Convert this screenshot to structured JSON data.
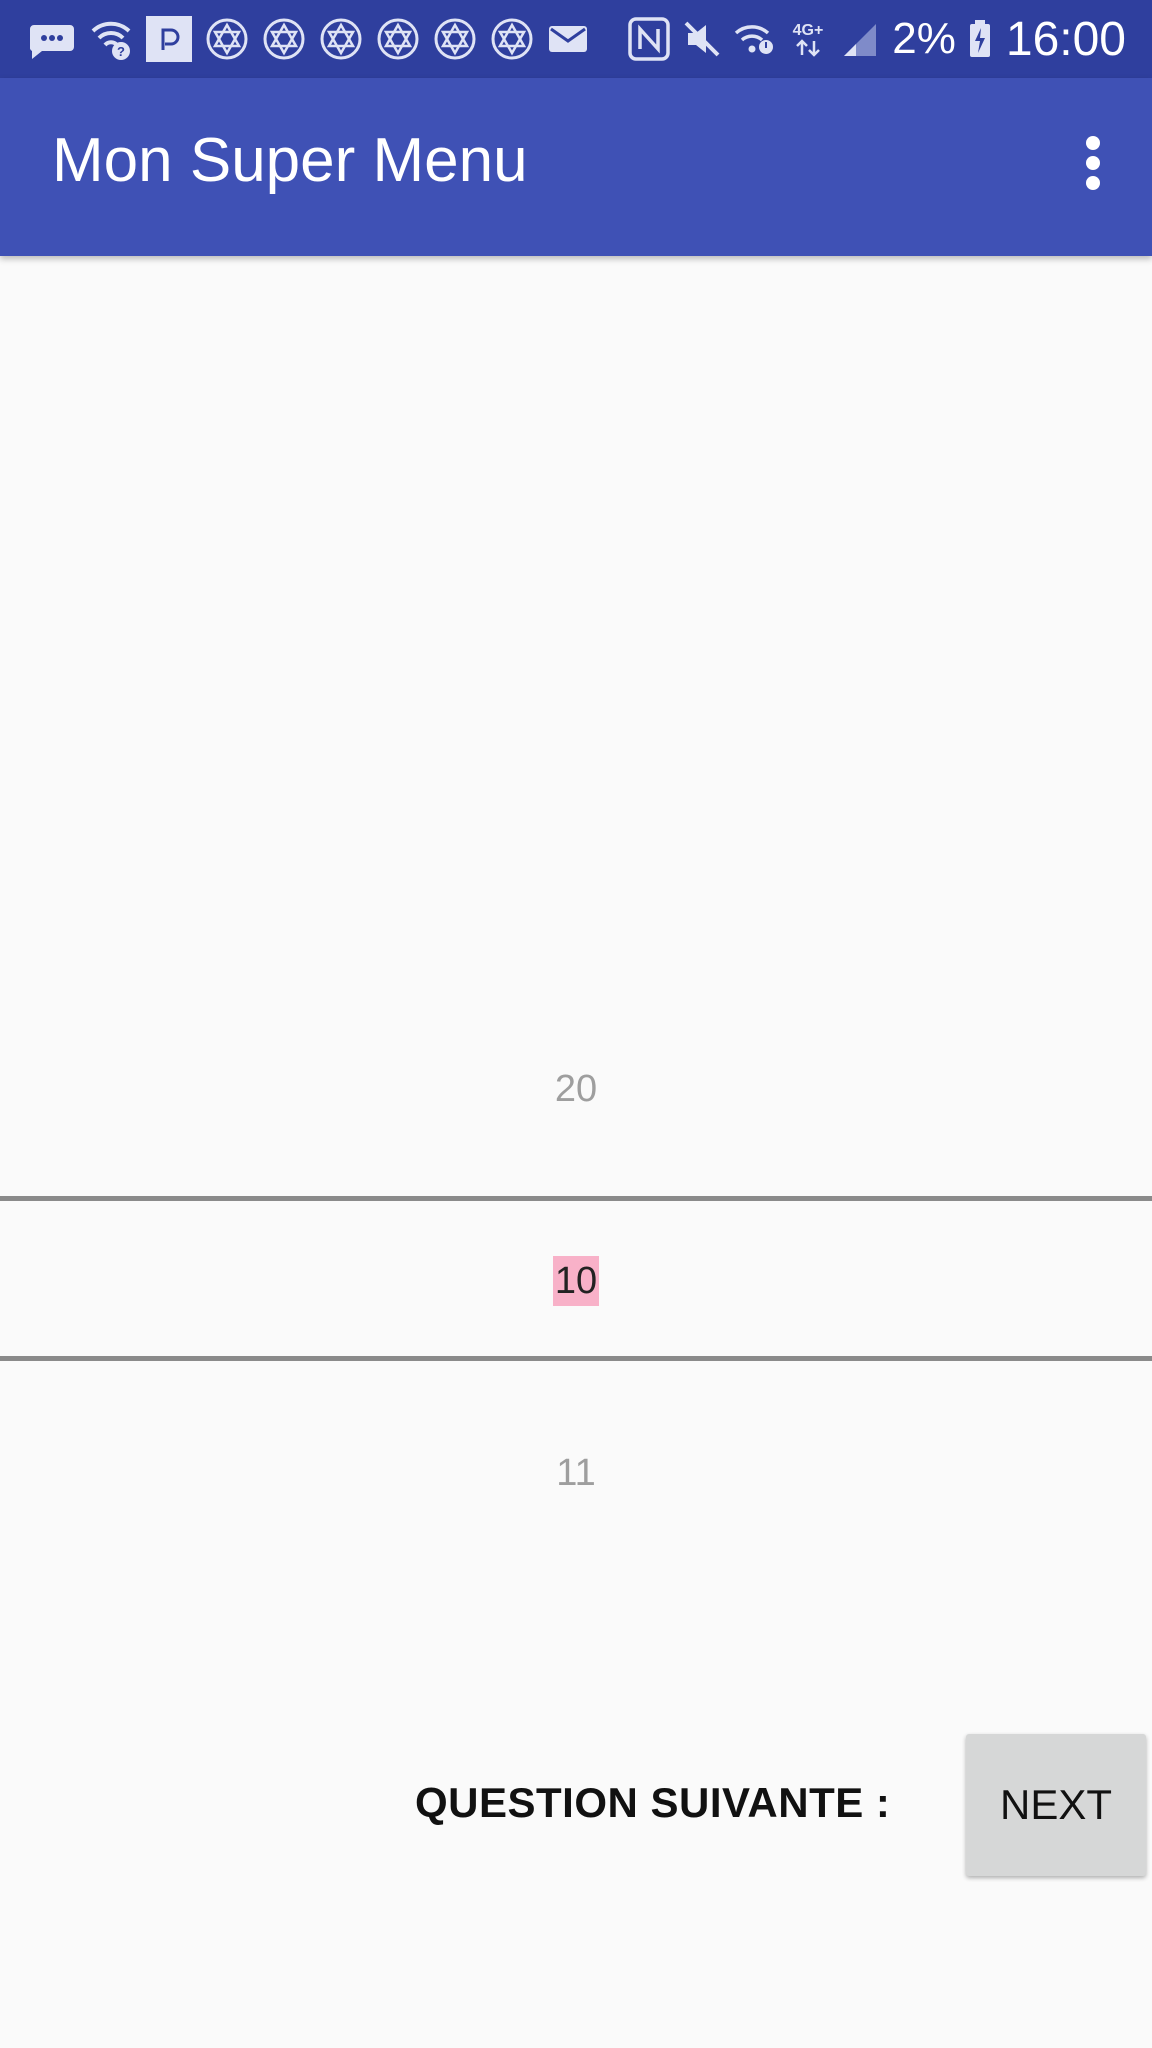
{
  "status_bar": {
    "battery_percent": "2%",
    "time": "16:00",
    "network_type": "4G+",
    "notification_icons": [
      "message-icon",
      "wifi-question-icon",
      "app-p-icon",
      "star-of-david-icon",
      "star-of-david-icon",
      "star-of-david-icon",
      "star-of-david-icon",
      "star-of-david-icon",
      "star-of-david-icon",
      "mail-icon"
    ],
    "system_icons": [
      "nfc-icon",
      "mute-icon",
      "wifi-alert-icon",
      "signal-icon",
      "battery-charging-icon"
    ]
  },
  "app_bar": {
    "title": "Mon Super Menu",
    "overflow_icon": "more-vert-icon",
    "color": "#3f51b5",
    "status_color": "#2f3f9e"
  },
  "number_picker": {
    "previous_value": "20",
    "selected_value": "10",
    "next_value": "11",
    "highlight_color": "#f8b1c8"
  },
  "footer": {
    "label": "QUESTION SUIVANTE :",
    "button_label": "NEXT"
  }
}
